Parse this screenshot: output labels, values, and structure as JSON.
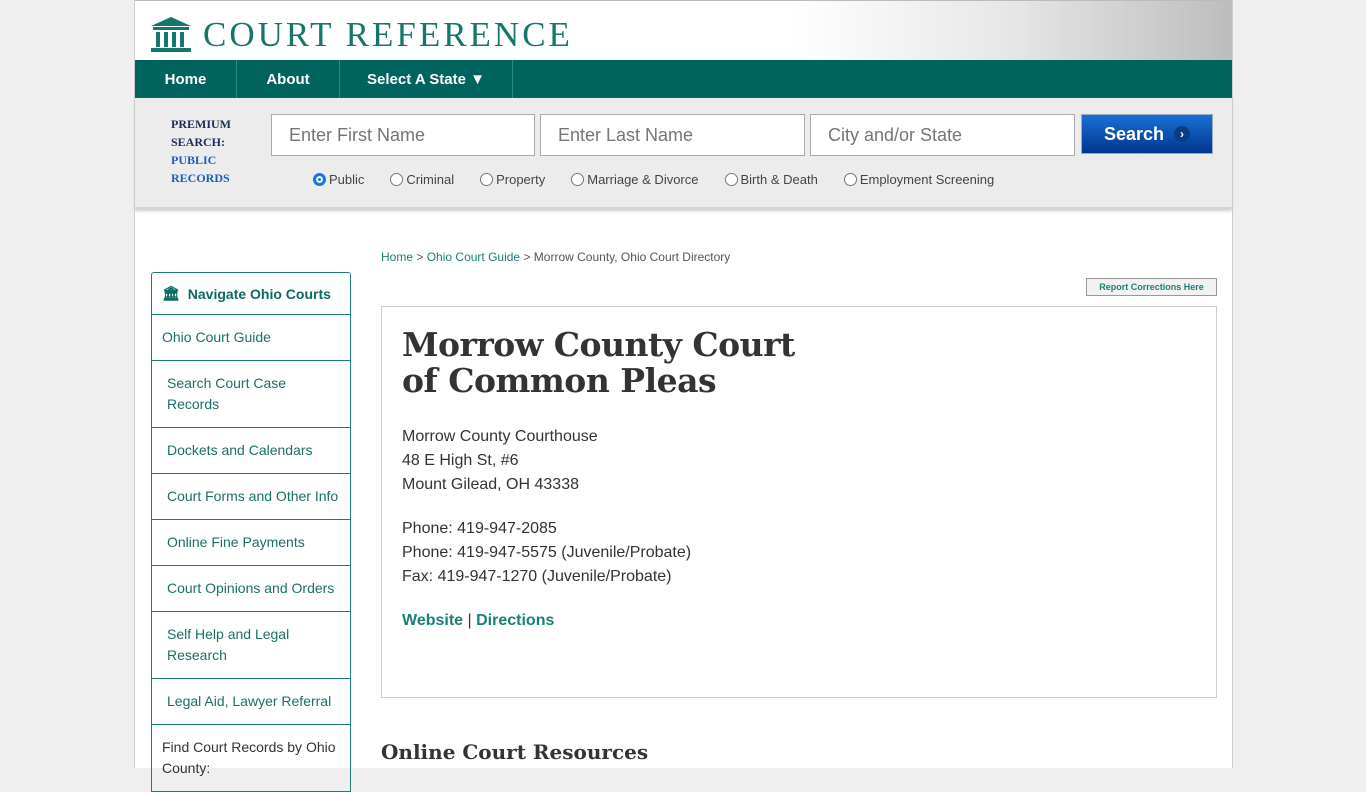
{
  "logo": {
    "text": "COURT REFERENCE"
  },
  "nav": [
    {
      "label": "Home"
    },
    {
      "label": "About"
    },
    {
      "label": "Select A State ▼"
    }
  ],
  "search": {
    "label1": "PREMIUM",
    "label2": "SEARCH:",
    "label3": "PUBLIC",
    "label4": "RECORDS",
    "first_placeholder": "Enter First Name",
    "last_placeholder": "Enter Last Name",
    "city_placeholder": "City and/or State",
    "button": "Search",
    "options": [
      {
        "label": "Public",
        "selected": true
      },
      {
        "label": "Criminal"
      },
      {
        "label": "Property"
      },
      {
        "label": "Marriage & Divorce"
      },
      {
        "label": "Birth & Death"
      },
      {
        "label": "Employment Screening"
      }
    ]
  },
  "sidebar": {
    "title": "Navigate Ohio Courts",
    "items": [
      {
        "label": "Ohio Court Guide"
      },
      {
        "label": "Search Court Case Records"
      },
      {
        "label": "Dockets and Calendars"
      },
      {
        "label": "Court Forms and Other Info"
      },
      {
        "label": "Online Fine Payments"
      },
      {
        "label": "Court Opinions and Orders"
      },
      {
        "label": "Self Help and Legal Research"
      },
      {
        "label": "Legal Aid, Lawyer Referral"
      },
      {
        "label": "Find Court Records by Ohio County:"
      }
    ]
  },
  "breadcrumb": {
    "home": "Home",
    "guide": "Ohio Court Guide",
    "current": "> Morrow County, Ohio Court Directory",
    "sep": ">"
  },
  "report": "Report Corrections Here",
  "court": {
    "title": "Morrow County Court of Common Pleas",
    "addr1": "Morrow County Courthouse",
    "addr2": "48 E High St, #6",
    "addr3": "Mount Gilead, OH 43338",
    "phone1": "Phone: 419-947-2085",
    "phone2": "Phone: 419-947-5575 (Juvenile/Probate)",
    "fax": "Fax: 419-947-1270 (Juvenile/Probate)",
    "website": "Website",
    "sep": "|",
    "directions": "Directions"
  },
  "resources_title": "Online Court Resources"
}
